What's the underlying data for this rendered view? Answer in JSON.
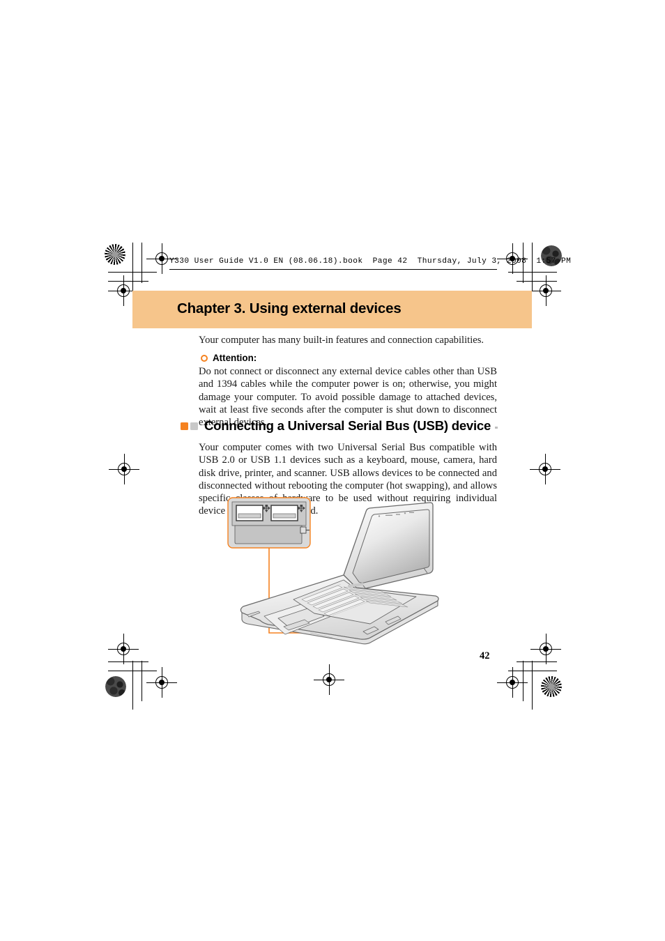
{
  "document": {
    "running_header": "Y330 User Guide V1.0 EN (08.06.18).book  Page 42  Thursday, July 3, 2008  1:57 PM",
    "page_number": "42"
  },
  "chapter": {
    "title": "Chapter 3. Using external devices",
    "banner_color": "#f6c58b"
  },
  "intro": {
    "paragraph": "Your computer has many built-in features and connection capabilities."
  },
  "attention": {
    "bullet_icon": "orange-ring-bullet-icon",
    "label": "Attention:",
    "body": "Do not connect or disconnect any external device cables other than USB and 1394 cables while the computer power is on; otherwise, you might damage your computer. To avoid possible damage to attached devices, wait at least five seconds after the computer is shut down to disconnect external devices."
  },
  "section": {
    "marker_orange": "#f58220",
    "marker_gray": "#c9c9c9",
    "title": "Connecting a Universal Serial Bus (USB) device",
    "rule_color": "#bdbdbd",
    "paragraph": "Your computer comes with two Universal Serial Bus compatible with USB 2.0 or USB 1.1 devices such as a keyboard, mouse, camera, hard disk drive, printer, and scanner. USB allows devices to be connected and disconnected without rebooting the computer (hot swapping), and allows specific classes of hardware to be used without requiring individual device drivers to be installed."
  },
  "illustration": {
    "name": "usb-port-callout-illustration",
    "callout_line_color": "#f58220",
    "callout_dot_color": "#f58220",
    "detail_label": "usb-ports-detail",
    "usb_port_count": 2,
    "usb_symbol": "usb-trident-icon",
    "laptop_label": "notebook-computer-drawing"
  },
  "print_marks": {
    "registration_icon": "registration-target-icon",
    "halftone_star_icon": "halftone-star-target-icon",
    "halftone_solid_icon": "halftone-density-patch-icon",
    "trim_mark": "trim-line"
  }
}
